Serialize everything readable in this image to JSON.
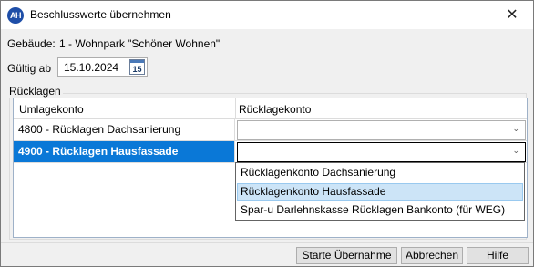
{
  "window": {
    "app_icon": "AH",
    "title": "Beschlusswerte übernehmen",
    "close": "✕"
  },
  "form": {
    "gebaeude_label": "Gebäude:",
    "gebaeude_value": "1 - Wohnpark \"Schöner Wohnen\"",
    "gueltig_label": "Gültig ab",
    "gueltig_value": "15.10.2024",
    "calendar_day": "15"
  },
  "ruecklagen": {
    "group_label": "Rücklagen",
    "columns": [
      "Umlagekonto",
      "Rücklagekonto"
    ],
    "rows": [
      {
        "umlagekonto": "4800 - Rücklagen Dachsanierung",
        "ruecklagekonto": "",
        "selected": false
      },
      {
        "umlagekonto": "4900 - Rücklagen Hausfassade",
        "ruecklagekonto": "",
        "selected": true
      }
    ],
    "dropdown_options": [
      "Rücklagenkonto Dachsanierung",
      "Rücklagenkonto Hausfassade",
      "Spar-u Darlehnskasse Rücklagen Bankonto  (für WEG)"
    ],
    "dropdown_highlighted": "Rücklagenkonto Hausfassade"
  },
  "buttons": {
    "start": "Starte Übernahme",
    "cancel": "Abbrechen",
    "help": "Hilfe"
  },
  "colors": {
    "selection": "#0a78d7",
    "hover": "#cce4f7"
  },
  "icons": [
    "app-logo-icon",
    "close-icon",
    "calendar-icon",
    "chevron-down-icon"
  ]
}
